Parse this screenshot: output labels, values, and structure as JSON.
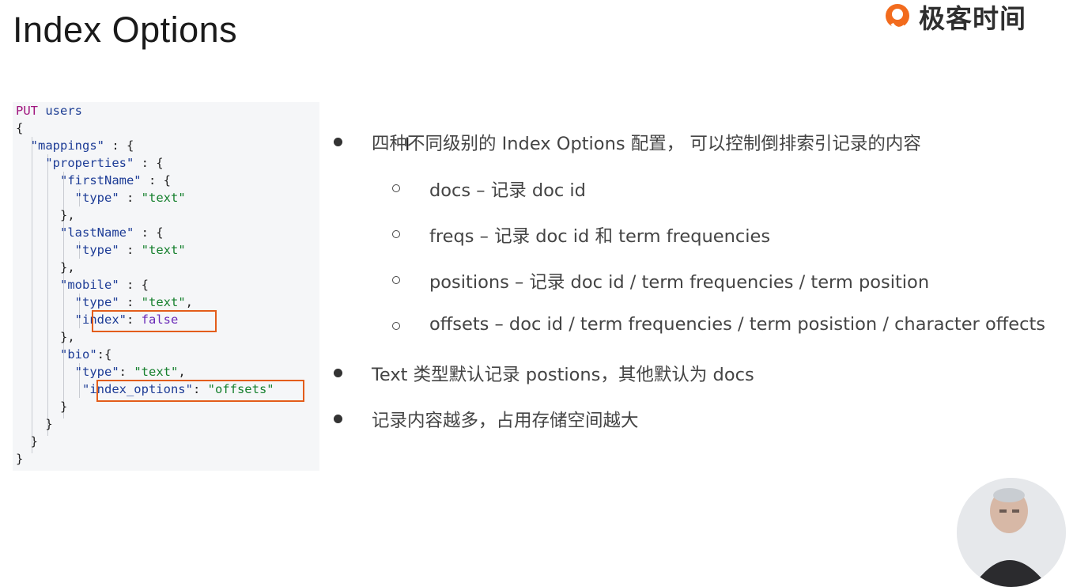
{
  "title": "Index Options",
  "brand": {
    "name": "极客时间",
    "accent": "#f26b1d"
  },
  "code": {
    "highlight_color": "#e35d1b",
    "lines": [
      [
        {
          "t": "PUT",
          "c": "kw"
        },
        {
          "t": " users",
          "c": "path"
        }
      ],
      [
        {
          "t": "{",
          "c": "pun"
        }
      ],
      [
        {
          "t": "  \"mappings\"",
          "c": "key"
        },
        {
          "t": " : {",
          "c": "pun"
        }
      ],
      [
        {
          "t": "    \"properties\"",
          "c": "key"
        },
        {
          "t": " : {",
          "c": "pun"
        }
      ],
      [
        {
          "t": "      \"firstName\"",
          "c": "key"
        },
        {
          "t": " : {",
          "c": "pun"
        }
      ],
      [
        {
          "t": "        \"type\"",
          "c": "key"
        },
        {
          "t": " : ",
          "c": "pun"
        },
        {
          "t": "\"text\"",
          "c": "str"
        }
      ],
      [
        {
          "t": "      },",
          "c": "pun"
        }
      ],
      [
        {
          "t": "      \"lastName\"",
          "c": "key"
        },
        {
          "t": " : {",
          "c": "pun"
        }
      ],
      [
        {
          "t": "        \"type\"",
          "c": "key"
        },
        {
          "t": " : ",
          "c": "pun"
        },
        {
          "t": "\"text\"",
          "c": "str"
        }
      ],
      [
        {
          "t": "      },",
          "c": "pun"
        }
      ],
      [
        {
          "t": "      \"mobile\"",
          "c": "key"
        },
        {
          "t": " : {",
          "c": "pun"
        }
      ],
      [
        {
          "t": "        \"type\"",
          "c": "key"
        },
        {
          "t": " : ",
          "c": "pun"
        },
        {
          "t": "\"text\"",
          "c": "str"
        },
        {
          "t": ",",
          "c": "pun"
        }
      ],
      [
        {
          "t": "        \"index\"",
          "c": "key"
        },
        {
          "t": ": ",
          "c": "pun"
        },
        {
          "t": "false",
          "c": "bool"
        }
      ],
      [
        {
          "t": "      },",
          "c": "pun"
        }
      ],
      [
        {
          "t": "      \"bio\"",
          "c": "key"
        },
        {
          "t": ":{",
          "c": "pun"
        }
      ],
      [
        {
          "t": "        \"type\"",
          "c": "key"
        },
        {
          "t": ": ",
          "c": "pun"
        },
        {
          "t": "\"text\"",
          "c": "str"
        },
        {
          "t": ",",
          "c": "pun"
        }
      ],
      [
        {
          "t": "         \"index_options\"",
          "c": "key"
        },
        {
          "t": ": ",
          "c": "pun"
        },
        {
          "t": "\"offsets\"",
          "c": "str"
        }
      ],
      [
        {
          "t": "      }",
          "c": "pun"
        }
      ],
      [
        {
          "t": "    }",
          "c": "pun"
        }
      ],
      [
        {
          "t": "  }",
          "c": "pun"
        }
      ],
      [
        {
          "t": "}",
          "c": "pun"
        }
      ]
    ]
  },
  "bullets": {
    "main": "四种不同级别的 Index Options 配置， 可以控制倒排索引记录的内容",
    "subs": [
      "docs – 记录 doc id",
      "freqs – 记录 doc id 和 term frequencies",
      "positions – 记录 doc id / term frequencies / term position",
      "offsets – doc id / term frequencies / term posistion / character offects"
    ],
    "others": [
      "Text 类型默认记录 postions，其他默认为 docs",
      "记录内容越多，占用存储空间越大"
    ]
  }
}
